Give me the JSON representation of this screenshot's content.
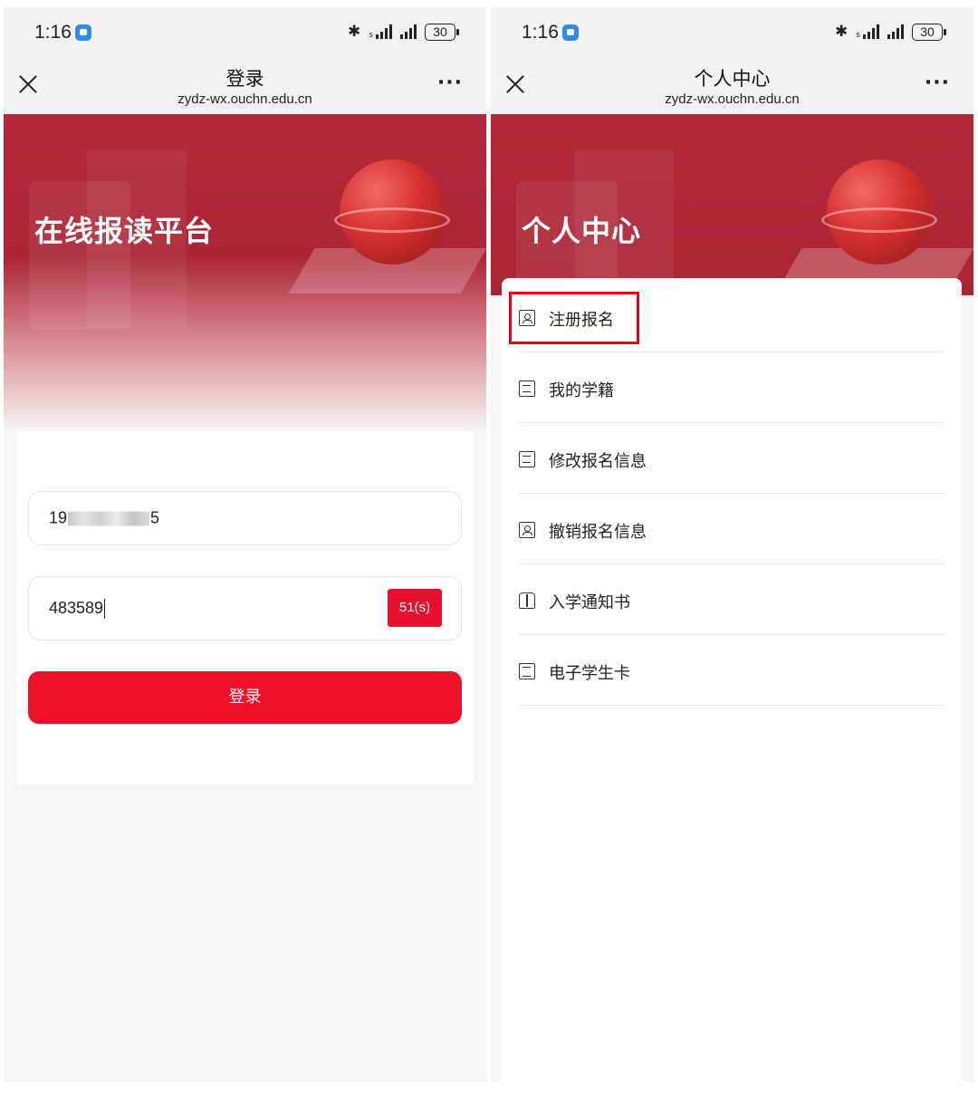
{
  "status_bar": {
    "time": "1:16",
    "battery": "30"
  },
  "login_screen": {
    "nav": {
      "title": "登录",
      "url": "zydz-wx.ouchn.edu.cn",
      "more": "···"
    },
    "hero_title": "在线报读平台",
    "phone_field": {
      "value_prefix": "19",
      "value_suffix": "5"
    },
    "code_field": {
      "value": "483589",
      "countdown_button": "51(s)"
    },
    "login_button": "登录"
  },
  "profile_screen": {
    "nav": {
      "title": "个人中心",
      "url": "zydz-wx.ouchn.edu.cn",
      "more": "···"
    },
    "hero_title": "个人中心",
    "menu_items": [
      {
        "label": "注册报名",
        "icon": "id-badge-icon"
      },
      {
        "label": "我的学籍",
        "icon": "document-icon"
      },
      {
        "label": "修改报名信息",
        "icon": "document-icon"
      },
      {
        "label": "撤销报名信息",
        "icon": "id-badge-icon"
      },
      {
        "label": "入学通知书",
        "icon": "open-book-icon"
      },
      {
        "label": "电子学生卡",
        "icon": "student-card-icon"
      }
    ]
  },
  "colors": {
    "brand_red": "#b2293a",
    "button_red": "#ec1028",
    "highlight": "#e50012"
  }
}
